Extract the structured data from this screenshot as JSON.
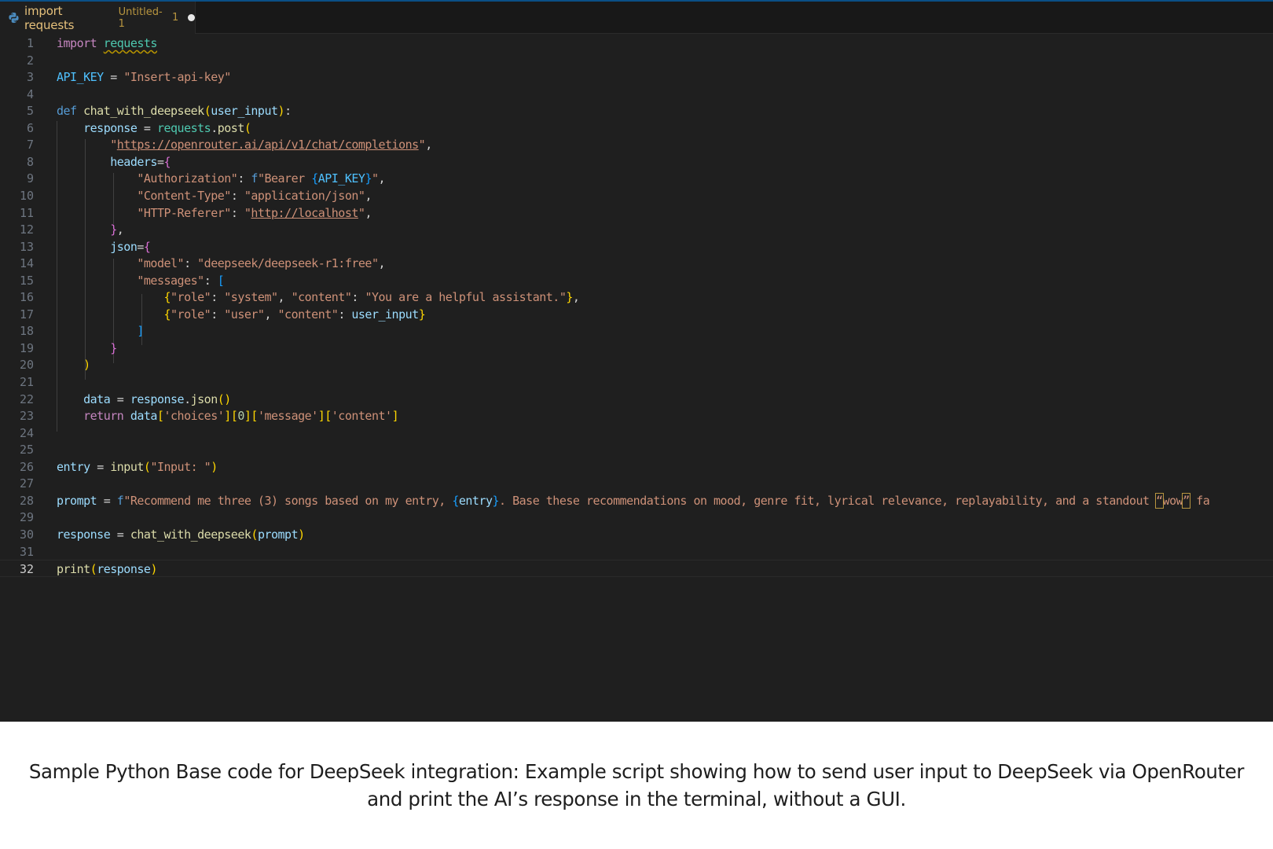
{
  "tab": {
    "icon": "python-icon",
    "title": "import requests",
    "subtitle": "Untitled-1",
    "problems": "1",
    "dirty_indicator": "dot-icon"
  },
  "editor": {
    "current_line": 32,
    "lines": [
      "import requests",
      "",
      "API_KEY = \"Insert-api-key\"",
      "",
      "def chat_with_deepseek(user_input):",
      "    response = requests.post(",
      "        \"https://openrouter.ai/api/v1/chat/completions\",",
      "        headers={",
      "            \"Authorization\": f\"Bearer {API_KEY}\",",
      "            \"Content-Type\": \"application/json\",",
      "            \"HTTP-Referer\": \"http://localhost\",",
      "        },",
      "        json={",
      "            \"model\": \"deepseek/deepseek-r1:free\",",
      "            \"messages\": [",
      "                {\"role\": \"system\", \"content\": \"You are a helpful assistant.\"},",
      "                {\"role\": \"user\", \"content\": user_input}",
      "            ]",
      "        }",
      "    )",
      "",
      "    data = response.json()",
      "    return data['choices'][0]['message']['content']",
      "",
      "",
      "entry = input(\"Input: \")",
      "",
      "prompt = f\"Recommend me three (3) songs based on my entry, {entry}. Base these recommendations on mood, genre fit, lyrical relevance, replayability, and a standout “wow” fa",
      "",
      "response = chat_with_deepseek(prompt)",
      "",
      "print(response)"
    ]
  },
  "caption": {
    "text": "Sample Python Base code for DeepSeek integration: Example script showing how to send user input to DeepSeek via OpenRouter and print the AI’s response in the terminal, without a GUI."
  },
  "colors": {
    "editor_background": "#1f1f1f",
    "tab_bar_background": "#181818",
    "keyword": "#c586c0",
    "string": "#ce9178",
    "function": "#dcdcaa",
    "variable": "#9cdcfe",
    "caption_text": "#1e1e1e"
  }
}
